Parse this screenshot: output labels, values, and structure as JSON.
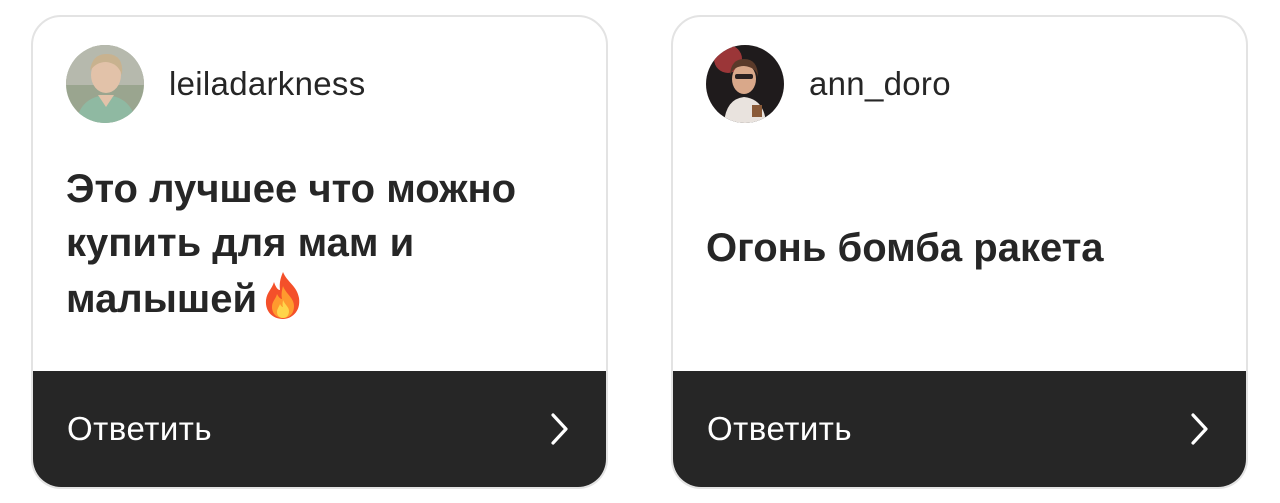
{
  "cards": [
    {
      "username": "leiladarkness",
      "message": "Это лучшее что можно купить для мам и малышей",
      "emoji": "fire-emoji",
      "reply_label": "Ответить",
      "avatar_icon": "user-avatar-leiladarkness",
      "chevron_icon": "chevron-right-icon"
    },
    {
      "username": "ann_doro",
      "message": "Огонь бомба ракета",
      "reply_label": "Ответить",
      "avatar_icon": "user-avatar-ann-doro",
      "chevron_icon": "chevron-right-icon"
    }
  ],
  "colors": {
    "card_border": "#e3e3e3",
    "reply_bar": "#262626",
    "text": "#262626",
    "reply_text": "#ffffff"
  }
}
